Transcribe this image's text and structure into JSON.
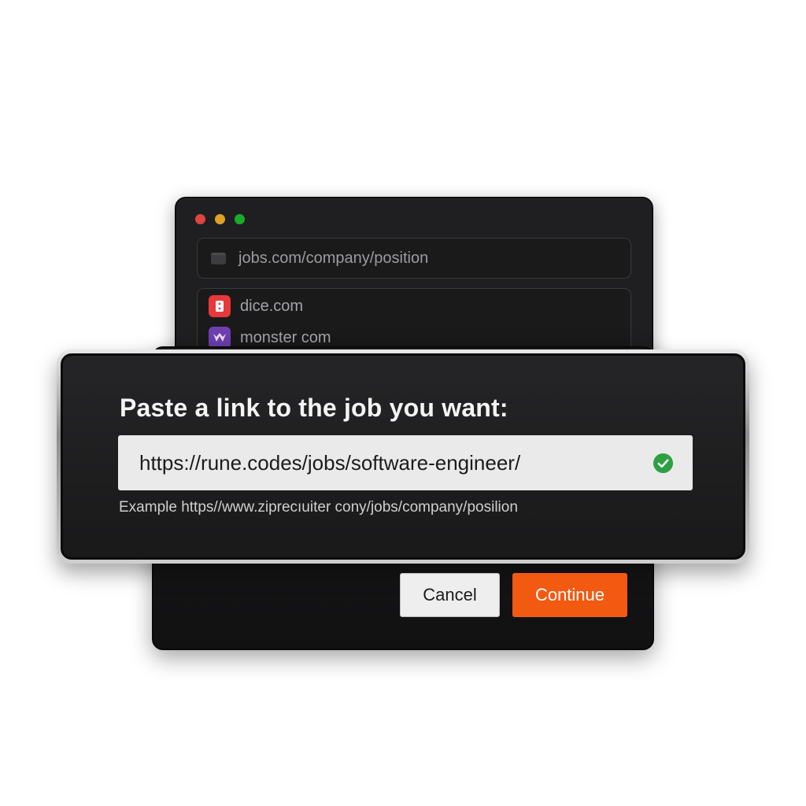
{
  "browser": {
    "address_bar": {
      "text": "jobs.com/company/position",
      "icon": "tab-icon"
    },
    "suggestions": [
      {
        "label": "dice.com",
        "icon": "dice-icon",
        "color": "#e8383b"
      },
      {
        "label": "monster com",
        "icon": "monster-icon",
        "color": "#6e3fb0"
      }
    ],
    "traffic_lights": [
      "#e0443e",
      "#dea123",
      "#1aab29"
    ]
  },
  "dialog": {
    "title": "Paste a link to the job you want:",
    "url_input": {
      "value": "https://rune.codes/jobs/software-engineer/",
      "status_icon": "check-circle-icon",
      "status_color": "#2ea043"
    },
    "example": "Example  https//www.ziprecıuiter cony/jobs/company/posilion"
  },
  "buttons": {
    "cancel_label": "Cancel",
    "continue_label": "Continue",
    "continue_color": "#f35a11"
  }
}
